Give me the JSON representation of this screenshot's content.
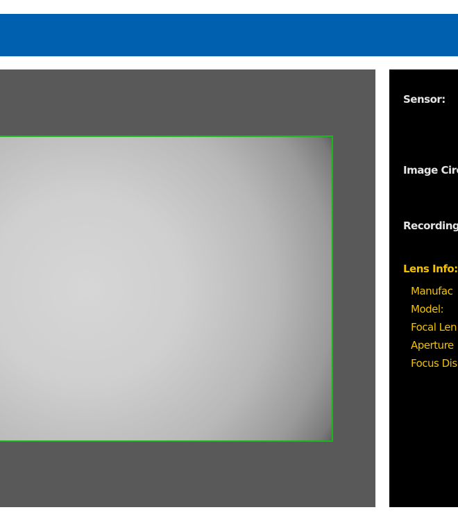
{
  "header": {
    "color": "#0060b0"
  },
  "viewport": {
    "frame_color": "#18b818"
  },
  "info_panel": {
    "sensor_label": "Sensor:",
    "image_circle_label": "Image Circ",
    "recording_label": "Recording",
    "lens_info_heading": "Lens Info:",
    "lens_items": [
      "Manufac",
      "Model:",
      "Focal Len",
      "Aperture",
      "Focus Dis"
    ],
    "accent_color": "#f2c200"
  }
}
